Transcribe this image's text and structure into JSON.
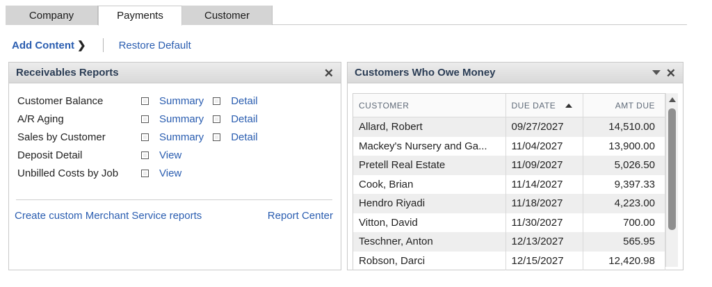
{
  "tabs": [
    {
      "label": "Company"
    },
    {
      "label": "Payments"
    },
    {
      "label": "Customer"
    }
  ],
  "toolbar": {
    "add_content": "Add Content",
    "add_content_chevron": "❯",
    "restore_default": "Restore Default"
  },
  "receivables": {
    "title": "Receivables Reports",
    "close_glyph": "✕",
    "reports": [
      {
        "name": "Customer Balance",
        "link1": "Summary",
        "link2": "Detail"
      },
      {
        "name": "A/R Aging",
        "link1": "Summary",
        "link2": "Detail"
      },
      {
        "name": "Sales by Customer",
        "link1": "Summary",
        "link2": "Detail"
      },
      {
        "name": "Deposit Detail",
        "link1": "View"
      },
      {
        "name": "Unbilled Costs by Job",
        "link1": "View"
      }
    ],
    "footer_left": "Create custom Merchant Service reports",
    "footer_right": "Report Center"
  },
  "owe": {
    "title": "Customers Who Owe Money",
    "close_glyph": "✕",
    "columns": [
      "CUSTOMER",
      "DUE DATE",
      "AMT DUE"
    ],
    "rows": [
      {
        "customer": "Allard, Robert",
        "due": "09/27/2027",
        "amt": "14,510.00"
      },
      {
        "customer": "Mackey's Nursery and Ga...",
        "due": "11/04/2027",
        "amt": "13,900.00"
      },
      {
        "customer": "Pretell Real Estate",
        "due": "11/09/2027",
        "amt": "5,026.50"
      },
      {
        "customer": "Cook, Brian",
        "due": "11/14/2027",
        "amt": "9,397.33"
      },
      {
        "customer": "Hendro Riyadi",
        "due": "11/18/2027",
        "amt": "4,223.00"
      },
      {
        "customer": "Vitton, David",
        "due": "11/30/2027",
        "amt": "700.00"
      },
      {
        "customer": "Teschner, Anton",
        "due": "12/13/2027",
        "amt": "565.95"
      },
      {
        "customer": "Robson, Darci",
        "due": "12/15/2027",
        "amt": "12,420.98"
      }
    ]
  },
  "colors": {
    "link": "#2a5db0",
    "header_title": "#2b3d55",
    "tab_inactive": "#d4d4d4"
  }
}
